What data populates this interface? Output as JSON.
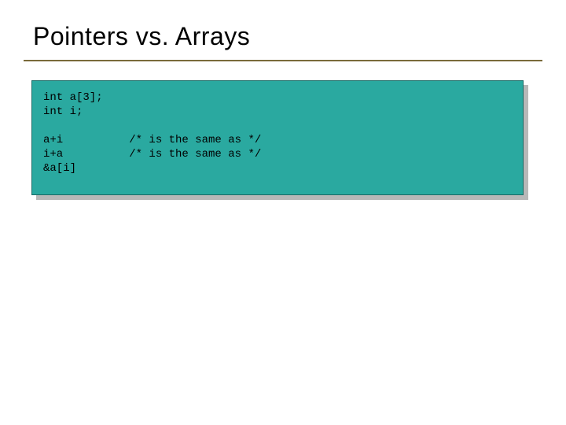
{
  "slide": {
    "title": "Pointers vs. Arrays"
  },
  "code": {
    "line1": "int a[3];",
    "line2": "int i;",
    "line3": "",
    "line4": "a+i          /* is the same as */",
    "line5": "i+a          /* is the same as */",
    "line6": "&a[i]"
  }
}
